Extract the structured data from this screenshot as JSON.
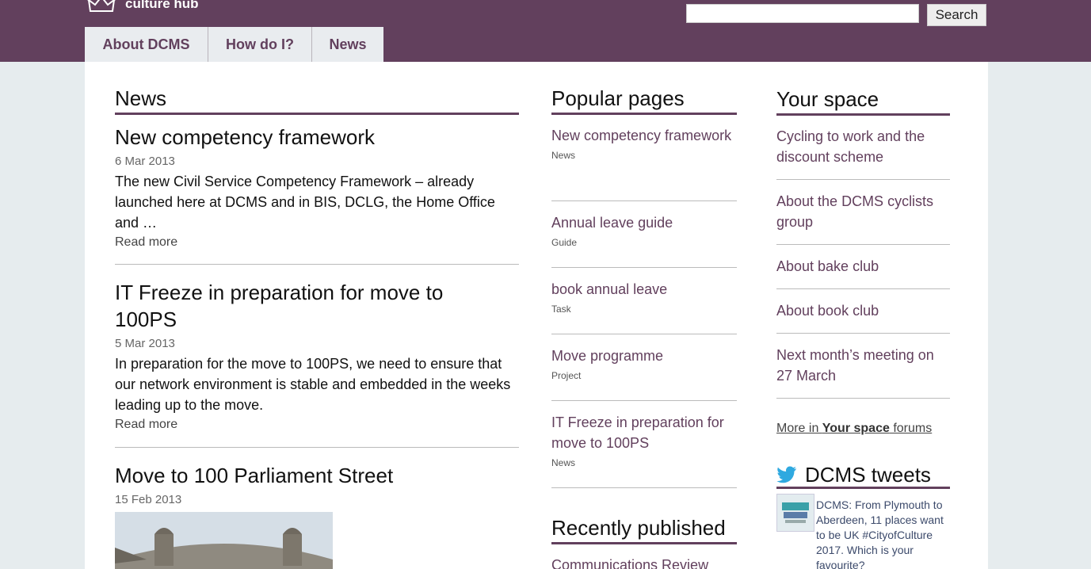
{
  "header": {
    "logo_text": "culture hub",
    "search_placeholder": "",
    "search_button": "Search"
  },
  "nav": {
    "tabs": [
      {
        "label": "About DCMS"
      },
      {
        "label": "How do I?"
      },
      {
        "label": "News"
      }
    ]
  },
  "news": {
    "heading": "News",
    "items": [
      {
        "title": "New competency framework",
        "date": "6 Mar 2013",
        "summary": "The new Civil Service Competency Framework – already launched here at DCMS and in BIS, DCLG, the Home Office and …",
        "read_more": "Read more"
      },
      {
        "title": "IT Freeze in preparation for move to 100PS",
        "date": "5 Mar 2013",
        "summary": "In preparation for the move to 100PS, we need to ensure that our network environment is stable and embedded in the weeks leading up to the move.",
        "read_more": "Read more"
      },
      {
        "title": "Move to 100 Parliament Street",
        "date": "15 Feb 2013"
      }
    ]
  },
  "popular": {
    "heading": "Popular pages",
    "items": [
      {
        "title": "New competency framework",
        "type": "News"
      },
      {
        "title": "Annual leave guide",
        "type": "Guide"
      },
      {
        "title": "book annual leave",
        "type": "Task"
      },
      {
        "title": "Move programme",
        "type": "Project"
      },
      {
        "title": "IT Freeze in preparation for move to 100PS",
        "type": "News"
      }
    ],
    "recent_heading": "Recently published",
    "recent_first": "Communications Review"
  },
  "space": {
    "heading": "Your space",
    "items": [
      {
        "title": "Cycling to work and the discount scheme"
      },
      {
        "title": "About the DCMS cyclists group"
      },
      {
        "title": "About bake club"
      },
      {
        "title": "About book club"
      },
      {
        "title": "Next month’s meeting on 27 March"
      }
    ],
    "more_prefix": "More in ",
    "more_bold": "Your space",
    "more_suffix": " forums",
    "tweets_heading": "DCMS tweets",
    "tweet_text": "DCMS: From Plymouth to Aberdeen, 11 places want to be UK #CityofCulture 2017. Which is your favourite?"
  },
  "colors": {
    "brand": "#62405d",
    "link": "#62405d",
    "background": "#e6ecee"
  },
  "icons": {
    "logo": "crown-icon",
    "twitter": "twitter-bird-icon"
  }
}
